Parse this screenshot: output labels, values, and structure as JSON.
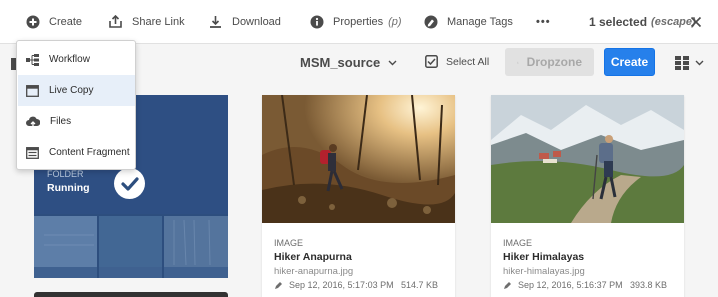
{
  "actionbar": {
    "create_label": "Create",
    "share_label": "Share Link",
    "download_label": "Download",
    "properties_label": "Properties",
    "properties_key": "(p)",
    "manage_tags_label": "Manage Tags",
    "more_label": "•••",
    "selection_count": "1 selected",
    "escape_key": "(escape)"
  },
  "toolbar": {
    "source_title": "MSM_source",
    "select_all_label": "Select All",
    "dropzone_label": "Dropzone",
    "create_label": "Create"
  },
  "create_menu": {
    "items": [
      {
        "label": "Workflow",
        "icon": "workflow-icon"
      },
      {
        "label": "Live Copy",
        "icon": "live-copy-icon"
      },
      {
        "label": "Files",
        "icon": "upload-cloud-icon"
      },
      {
        "label": "Content Fragment",
        "icon": "content-fragment-icon"
      }
    ]
  },
  "folder_card": {
    "type": "FOLDER",
    "name": "Running",
    "selected": true
  },
  "cards": [
    {
      "type": "IMAGE",
      "title": "Hiker Anapurna",
      "filename": "hiker-anapurna.jpg",
      "modified": "Sep 12, 2016, 5:17:03 PM",
      "size": "514.7 KB"
    },
    {
      "type": "IMAGE",
      "title": "Hiker Himalayas",
      "filename": "hiker-himalayas.jpg",
      "modified": "Sep 12, 2016, 5:16:37 PM",
      "size": "393.8 KB"
    }
  ],
  "colors": {
    "accent": "#2680eb",
    "folder_bg": "#2d4e7e",
    "menu_highlight": "#e7eff9"
  }
}
